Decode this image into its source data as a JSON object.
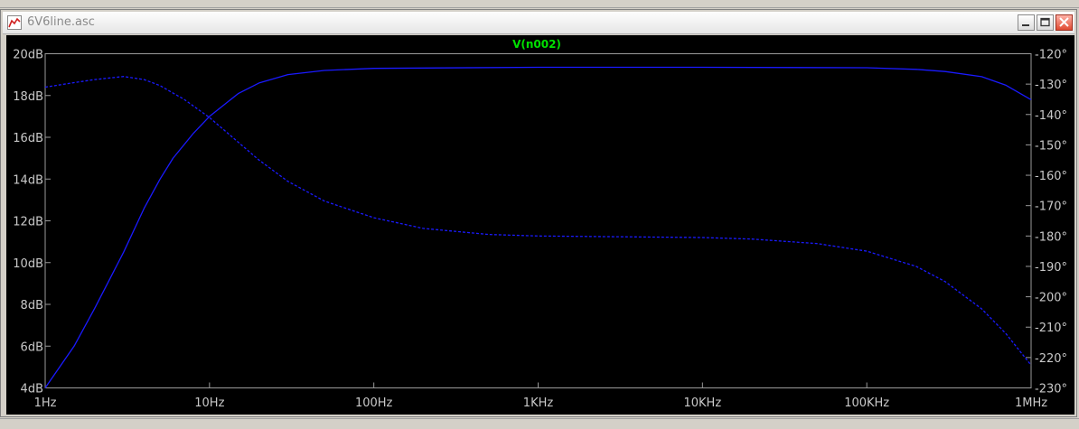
{
  "window": {
    "title": "6V6line.asc",
    "icon": "waveform-icon"
  },
  "colors": {
    "plot_bg": "#000000",
    "trace": "#1a1aff",
    "axis_text": "#c8c8c8",
    "trace_label": "#00e000"
  },
  "chart_data": {
    "type": "line",
    "title": "V(n002)",
    "x_scale": "log",
    "xlim": [
      1,
      1000000
    ],
    "x_ticks": [
      {
        "value": 1,
        "label": "1Hz"
      },
      {
        "value": 10,
        "label": "10Hz"
      },
      {
        "value": 100,
        "label": "100Hz"
      },
      {
        "value": 1000,
        "label": "1KHz"
      },
      {
        "value": 10000,
        "label": "10KHz"
      },
      {
        "value": 100000,
        "label": "100KHz"
      },
      {
        "value": 1000000,
        "label": "1MHz"
      }
    ],
    "ylim_left": [
      4,
      20
    ],
    "y_ticks_left": [
      {
        "value": 20,
        "label": "20dB"
      },
      {
        "value": 18,
        "label": "18dB"
      },
      {
        "value": 16,
        "label": "16dB"
      },
      {
        "value": 14,
        "label": "14dB"
      },
      {
        "value": 12,
        "label": "12dB"
      },
      {
        "value": 10,
        "label": "10dB"
      },
      {
        "value": 8,
        "label": "8dB"
      },
      {
        "value": 6,
        "label": "6dB"
      },
      {
        "value": 4,
        "label": "4dB"
      }
    ],
    "ylim_right": [
      -230,
      -120
    ],
    "y_ticks_right": [
      {
        "value": -120,
        "label": "-120°"
      },
      {
        "value": -130,
        "label": "-130°"
      },
      {
        "value": -140,
        "label": "-140°"
      },
      {
        "value": -150,
        "label": "-150°"
      },
      {
        "value": -160,
        "label": "-160°"
      },
      {
        "value": -170,
        "label": "-170°"
      },
      {
        "value": -180,
        "label": "-180°"
      },
      {
        "value": -190,
        "label": "-190°"
      },
      {
        "value": -200,
        "label": "-200°"
      },
      {
        "value": -210,
        "label": "-210°"
      },
      {
        "value": -220,
        "label": "-220°"
      },
      {
        "value": -230,
        "label": "-230°"
      }
    ],
    "series": [
      {
        "axis": "left",
        "style": "solid",
        "points": [
          [
            1,
            4.0
          ],
          [
            1.5,
            6.0
          ],
          [
            2,
            7.8
          ],
          [
            3,
            10.5
          ],
          [
            4,
            12.6
          ],
          [
            5,
            14.0
          ],
          [
            6,
            15.0
          ],
          [
            8,
            16.2
          ],
          [
            10,
            17.0
          ],
          [
            15,
            18.1
          ],
          [
            20,
            18.6
          ],
          [
            30,
            19.0
          ],
          [
            50,
            19.2
          ],
          [
            100,
            19.3
          ],
          [
            1000,
            19.35
          ],
          [
            10000,
            19.35
          ],
          [
            100000,
            19.33
          ],
          [
            200000,
            19.25
          ],
          [
            300000,
            19.15
          ],
          [
            500000,
            18.9
          ],
          [
            700000,
            18.5
          ],
          [
            1000000,
            17.8
          ]
        ]
      },
      {
        "axis": "right",
        "style": "dashed",
        "points": [
          [
            1,
            -131
          ],
          [
            1.5,
            -129.5
          ],
          [
            2,
            -128.5
          ],
          [
            3,
            -127.5
          ],
          [
            4,
            -128.5
          ],
          [
            5,
            -130.5
          ],
          [
            7,
            -135
          ],
          [
            10,
            -141
          ],
          [
            20,
            -155
          ],
          [
            30,
            -162
          ],
          [
            50,
            -168.5
          ],
          [
            100,
            -174
          ],
          [
            200,
            -177.5
          ],
          [
            500,
            -179.5
          ],
          [
            1000,
            -180
          ],
          [
            10000,
            -180.5
          ],
          [
            20000,
            -181
          ],
          [
            50000,
            -182.5
          ],
          [
            100000,
            -185
          ],
          [
            200000,
            -190
          ],
          [
            300000,
            -195
          ],
          [
            500000,
            -204
          ],
          [
            700000,
            -212
          ],
          [
            1000000,
            -222.5
          ]
        ]
      }
    ]
  }
}
